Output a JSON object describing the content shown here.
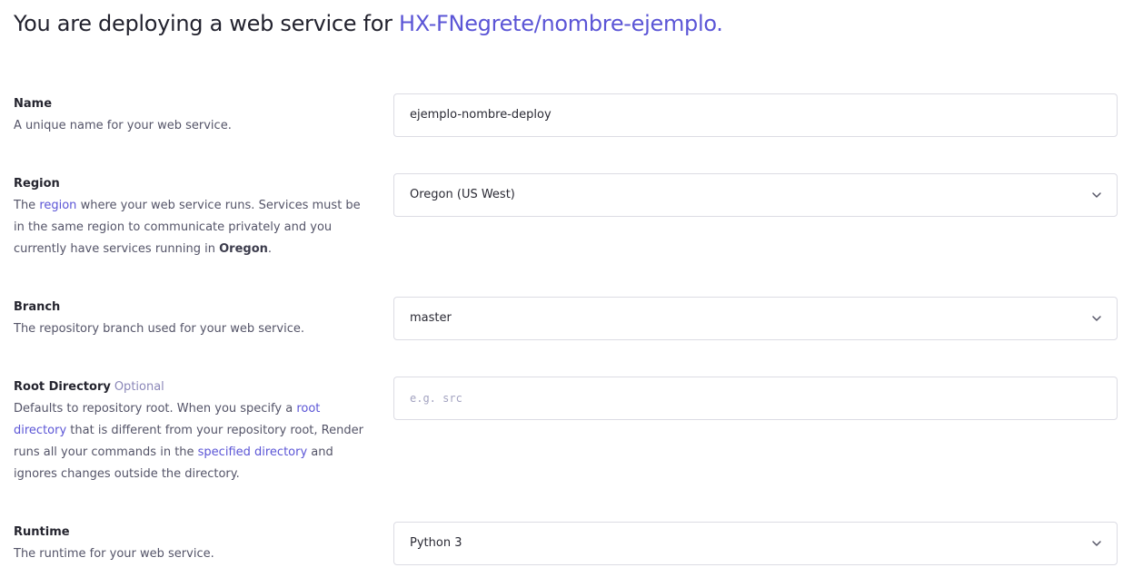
{
  "header": {
    "prefix": "You are deploying a web service for ",
    "repo": "HX-FNegrete/nombre-ejemplo."
  },
  "name": {
    "title": "Name",
    "description": "A unique name for your web service.",
    "value": "ejemplo-nombre-deploy"
  },
  "region": {
    "title": "Region",
    "desc_part1": "The ",
    "desc_link": "region",
    "desc_part2": " where your web service runs. Services must be in the same region to communicate privately and you currently have services running in ",
    "desc_strong": "Oregon",
    "desc_end": ".",
    "value": "Oregon (US West)",
    "icon": "chevron-down-icon"
  },
  "branch": {
    "title": "Branch",
    "description": "The repository branch used for your web service.",
    "value": "master",
    "icon": "chevron-down-icon"
  },
  "root_directory": {
    "title": "Root Directory",
    "optional": "Optional",
    "desc_part1": "Defaults to repository root. When you specify a ",
    "desc_link1": "root directory",
    "desc_part2": " that is different from your repository root, Render runs all your commands in the ",
    "desc_link2": "specified directory",
    "desc_part3": " and ignores changes outside the directory.",
    "placeholder": "e.g. src",
    "value": ""
  },
  "runtime": {
    "title": "Runtime",
    "description": "The runtime for your web service.",
    "value": "Python 3",
    "icon": "chevron-down-icon"
  },
  "colors": {
    "accent": "#5b55d6",
    "border": "#dcdce4",
    "text": "#2a2a34",
    "muted": "#545468"
  }
}
